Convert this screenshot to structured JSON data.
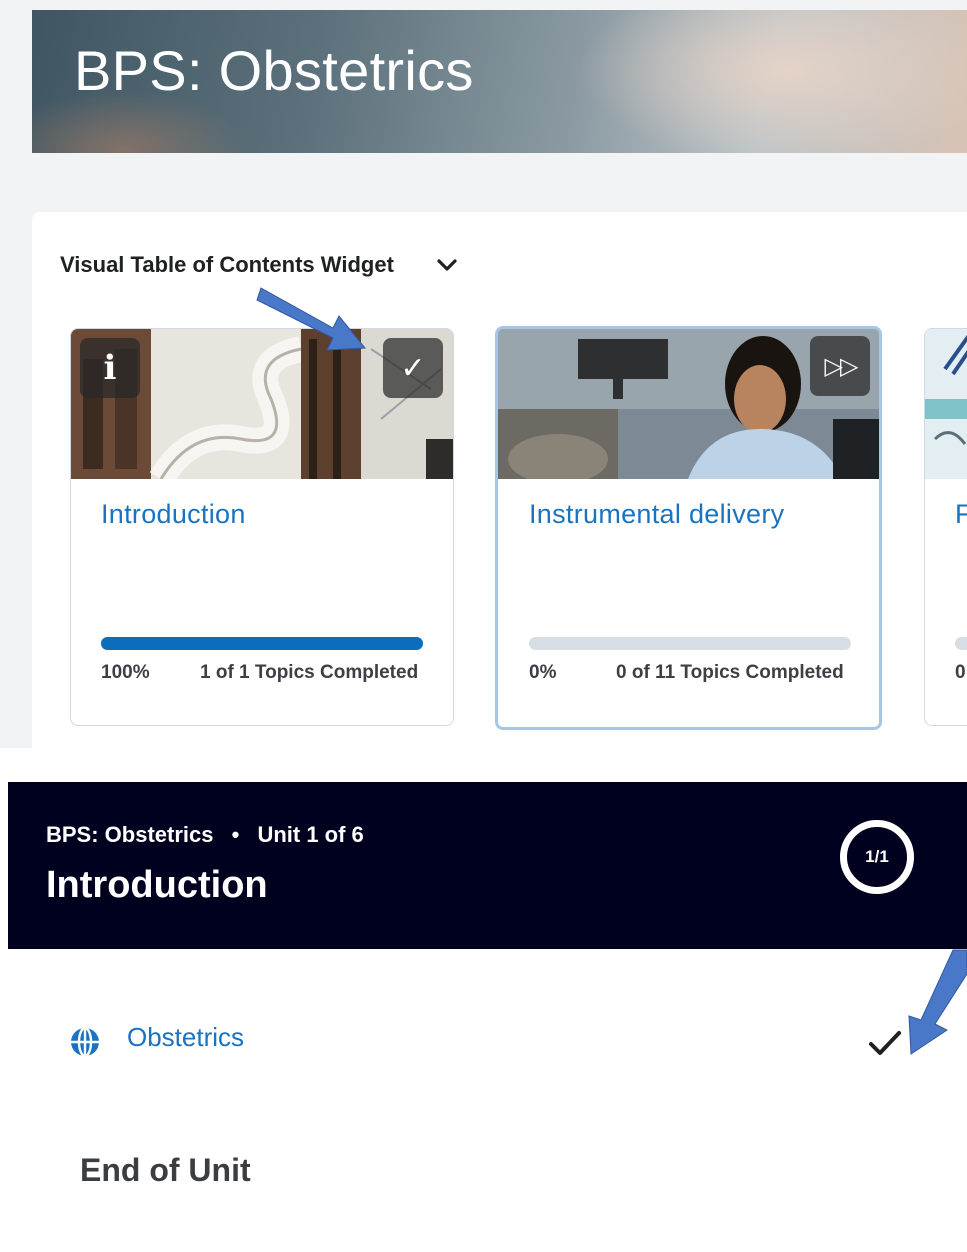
{
  "banner": {
    "title": "BPS: Obstetrics"
  },
  "widget": {
    "title": "Visual Table of Contents Widget",
    "toggle_icon": "chevron-down-icon"
  },
  "cards": [
    {
      "title": "Introduction",
      "percent": "100%",
      "progress": 1.0,
      "topics": "1 of 1 Topics Completed",
      "left_icon": "info-icon",
      "right_icon": "checkmark-icon",
      "right_icon_symbol": "✓",
      "left_icon_symbol": "i"
    },
    {
      "title": "Instrumental delivery",
      "percent": "0%",
      "progress": 0.0,
      "topics": "0 of 11 Topics Completed",
      "right_icon": "fast-forward-icon",
      "right_icon_symbol": "▷▷"
    },
    {
      "title": "F",
      "percent": "0",
      "progress": 0.0
    }
  ],
  "unit": {
    "course": "BPS: Obstetrics",
    "separator": "•",
    "position": "Unit 1 of 6",
    "title": "Introduction",
    "progress_label": "1/1"
  },
  "topics": [
    {
      "label": "Obstetrics",
      "icon": "globe-icon",
      "status_icon": "checkmark-icon"
    }
  ],
  "footer": {
    "end_label": "End of Unit"
  },
  "colors": {
    "accent_link": "#1a73c1",
    "progress_fill": "#0a6ebd",
    "progress_track": "#d7dde5",
    "header_bg": "#00001f",
    "annotation_arrow": "#4a78c8"
  }
}
